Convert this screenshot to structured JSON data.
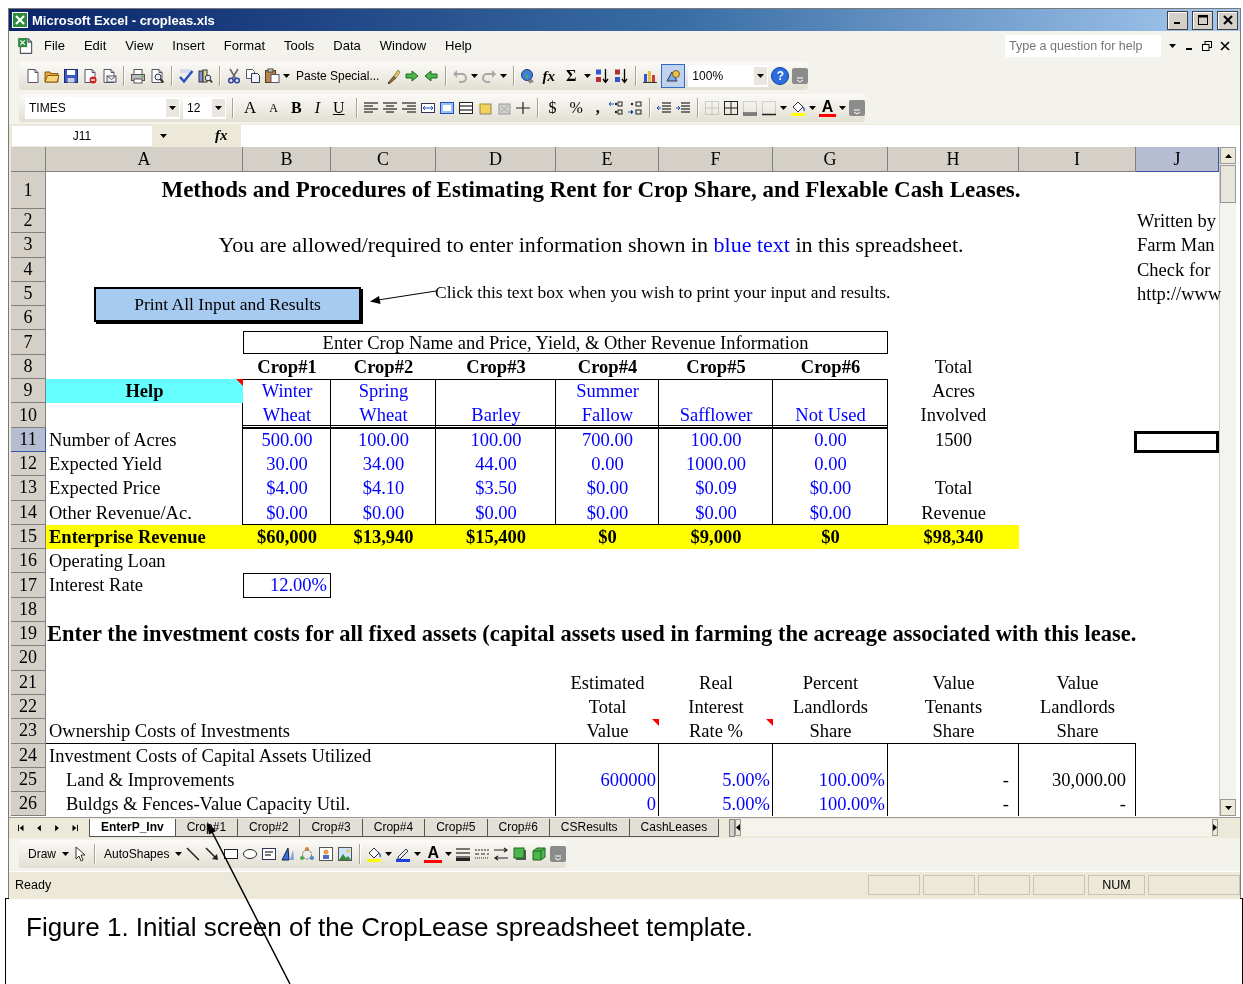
{
  "window": {
    "title": "Microsoft Excel - cropleas.xls"
  },
  "menu": [
    "File",
    "Edit",
    "View",
    "Insert",
    "Format",
    "Tools",
    "Data",
    "Window",
    "Help"
  ],
  "help_box": {
    "placeholder": "Type a question for help"
  },
  "standard_toolbar": {
    "paste_special": "Paste Special...",
    "undo": {
      "disabled": true
    },
    "redo": {
      "disabled": true
    },
    "function": "fx",
    "autosum": "Σ",
    "drawing": {
      "on": true
    },
    "zoom": "100%",
    "help": "?"
  },
  "formatting_toolbar": {
    "font": "TIMES",
    "size": "12",
    "grow_font": "A",
    "shrink_font": "A",
    "bold": "B",
    "italic": "I",
    "underline": "U",
    "currency": "$",
    "percent": "%",
    "comma": ",",
    "font_color": "A"
  },
  "formula_bar": {
    "name_box": "J11",
    "function": "fx"
  },
  "sheet": {
    "columns": [
      {
        "label": "A",
        "selected": false
      },
      {
        "label": "B",
        "selected": false
      },
      {
        "label": "C",
        "selected": false
      },
      {
        "label": "D",
        "selected": false
      },
      {
        "label": "E",
        "selected": false
      },
      {
        "label": "F",
        "selected": false
      },
      {
        "label": "G",
        "selected": false
      },
      {
        "label": "H",
        "selected": false
      },
      {
        "label": "I",
        "selected": false
      },
      {
        "label": "J",
        "selected": true
      }
    ],
    "rows": [
      {
        "number": "1",
        "selected": false,
        "cells": [
          {
            "kind": "title",
            "colspan": 9,
            "text": "Methods and Procedures of Estimating Rent for Crop Share, and Flexable Cash Leases."
          }
        ]
      },
      {
        "number": "2",
        "selected": false,
        "cells": [
          "",
          "",
          "",
          "",
          "",
          "",
          "",
          "",
          "",
          {
            "kind": "note",
            "text": "Written by"
          }
        ]
      },
      {
        "number": "3",
        "selected": false,
        "cells": [
          {
            "kind": "instruction",
            "colspan": 9,
            "segments": [
              {
                "kind": "plain",
                "text": "You are allowed/required to enter information shown in"
              },
              {
                "kind": "input",
                "text": "blue text"
              },
              {
                "kind": "plain",
                "text": "in this spreadsheet."
              }
            ]
          },
          "",
          "",
          "",
          "",
          "",
          "",
          "",
          "",
          {
            "kind": "note",
            "text": "Farm Man"
          }
        ]
      },
      {
        "number": "4",
        "selected": false,
        "cells": [
          "",
          "",
          "",
          "",
          "",
          "",
          "",
          "",
          "",
          {
            "kind": "note",
            "text": "Check for"
          }
        ]
      },
      {
        "number": "5",
        "selected": false,
        "cells": [
          "",
          "",
          "",
          "",
          "",
          "",
          "",
          "",
          "",
          {
            "kind": "note",
            "text": "http://www"
          }
        ]
      },
      {
        "number": "6",
        "selected": false,
        "cells": []
      },
      {
        "number": "7",
        "selected": false,
        "cells": [
          "",
          {
            "kind": "group",
            "colspan": 6,
            "text": "Enter Crop Name and Price, Yield, & Other Revenue Information"
          }
        ]
      },
      {
        "number": "8",
        "selected": false,
        "cells": [
          "",
          {
            "kind": "crop-head",
            "text": "Crop#1"
          },
          {
            "kind": "crop-head",
            "text": "Crop#2"
          },
          {
            "kind": "crop-head",
            "text": "Crop#3"
          },
          {
            "kind": "crop-head",
            "text": "Crop#4"
          },
          {
            "kind": "crop-head",
            "text": "Crop#5"
          },
          {
            "kind": "crop-head",
            "text": "Crop#6"
          },
          {
            "kind": "total",
            "text": "Total"
          }
        ]
      },
      {
        "number": "9",
        "selected": false,
        "cells": [
          {
            "kind": "help",
            "comment": true,
            "text": "Help"
          },
          {
            "kind": "input",
            "text": "Winter"
          },
          {
            "kind": "input",
            "text": "Spring"
          },
          "",
          {
            "kind": "input",
            "text": "Summer"
          },
          "",
          "",
          {
            "kind": "total",
            "text": "Acres"
          }
        ]
      },
      {
        "number": "10",
        "selected": false,
        "cells": [
          "",
          {
            "kind": "input",
            "text": "Wheat"
          },
          {
            "kind": "input",
            "text": "Wheat"
          },
          {
            "kind": "input",
            "text": "Barley"
          },
          {
            "kind": "input",
            "text": "Fallow"
          },
          {
            "kind": "input",
            "text": "Safflower"
          },
          {
            "kind": "input",
            "text": "Not Used"
          },
          {
            "kind": "total",
            "text": "Involved"
          }
        ]
      },
      {
        "number": "11",
        "selected": true,
        "cells": [
          {
            "kind": "label",
            "text": "Number of Acres"
          },
          {
            "kind": "input",
            "text": "500.00"
          },
          {
            "kind": "input",
            "text": "100.00"
          },
          {
            "kind": "input",
            "text": "100.00"
          },
          {
            "kind": "input",
            "text": "700.00"
          },
          {
            "kind": "input",
            "text": "100.00"
          },
          {
            "kind": "input",
            "text": "0.00"
          },
          {
            "kind": "total",
            "text": "1500"
          }
        ]
      },
      {
        "number": "12",
        "selected": false,
        "cells": [
          {
            "kind": "label",
            "text": "Expected Yield"
          },
          {
            "kind": "input",
            "text": "30.00"
          },
          {
            "kind": "input",
            "text": "34.00"
          },
          {
            "kind": "input",
            "text": "44.00"
          },
          {
            "kind": "input",
            "text": "0.00"
          },
          {
            "kind": "input",
            "text": "1000.00"
          },
          {
            "kind": "input",
            "text": "0.00"
          }
        ]
      },
      {
        "number": "13",
        "selected": false,
        "cells": [
          {
            "kind": "label",
            "text": "Expected Price"
          },
          {
            "kind": "input",
            "text": "$4.00"
          },
          {
            "kind": "input",
            "text": "$4.10"
          },
          {
            "kind": "input",
            "text": "$3.50"
          },
          {
            "kind": "input",
            "text": "$0.00"
          },
          {
            "kind": "input",
            "text": "$0.09"
          },
          {
            "kind": "input",
            "text": "$0.00"
          },
          {
            "kind": "total",
            "text": "Total"
          }
        ]
      },
      {
        "number": "14",
        "selected": false,
        "cells": [
          {
            "kind": "label",
            "text": "Other Revenue/Ac."
          },
          {
            "kind": "input",
            "text": "$0.00"
          },
          {
            "kind": "input",
            "text": "$0.00"
          },
          {
            "kind": "input",
            "text": "$0.00"
          },
          {
            "kind": "input",
            "text": "$0.00"
          },
          {
            "kind": "input",
            "text": "$0.00"
          },
          {
            "kind": "input",
            "text": "$0.00"
          },
          {
            "kind": "total",
            "text": "Revenue"
          }
        ]
      },
      {
        "number": "15",
        "selected": false,
        "cells": [
          {
            "kind": "revenue-label",
            "text": "Enterprise Revenue"
          },
          {
            "kind": "revenue",
            "text": "$60,000"
          },
          {
            "kind": "revenue",
            "text": "$13,940"
          },
          {
            "kind": "revenue",
            "text": "$15,400"
          },
          {
            "kind": "revenue",
            "text": "$0"
          },
          {
            "kind": "revenue",
            "text": "$9,000"
          },
          {
            "kind": "revenue",
            "text": "$0"
          },
          {
            "kind": "revenue",
            "text": "$98,340"
          }
        ]
      },
      {
        "number": "16",
        "selected": false,
        "cells": [
          {
            "kind": "label",
            "text": "Operating Loan"
          }
        ]
      },
      {
        "number": "17",
        "selected": false,
        "cells": [
          {
            "kind": "label",
            "text": "Interest Rate"
          },
          {
            "kind": "input-box",
            "text": "12.00%"
          }
        ]
      },
      {
        "number": "18",
        "selected": false,
        "cells": []
      },
      {
        "number": "19",
        "selected": false,
        "cells": [
          {
            "kind": "section",
            "text": "Enter the investment costs for all fixed assets (capital assets used in farming the acreage associated with this lease."
          }
        ]
      },
      {
        "number": "20",
        "selected": false,
        "cells": []
      },
      {
        "number": "21",
        "selected": false,
        "cells": [
          "",
          "",
          "",
          "",
          {
            "kind": "col-head",
            "text": "Estimated"
          },
          {
            "kind": "col-head",
            "text": "Real"
          },
          {
            "kind": "col-head",
            "text": "Percent"
          },
          {
            "kind": "col-head",
            "text": "Value"
          },
          {
            "kind": "col-head",
            "text": "Value"
          }
        ]
      },
      {
        "number": "22",
        "selected": false,
        "cells": [
          "",
          "",
          "",
          "",
          {
            "kind": "col-head",
            "text": "Total"
          },
          {
            "kind": "col-head",
            "text": "Interest"
          },
          {
            "kind": "col-head",
            "text": "Landlords"
          },
          {
            "kind": "col-head",
            "text": "Tenants"
          },
          {
            "kind": "col-head",
            "text": "Landlords"
          }
        ]
      },
      {
        "number": "23",
        "selected": false,
        "cells": [
          {
            "kind": "label",
            "text": "Ownership Costs of Investments"
          },
          "",
          "",
          "",
          {
            "kind": "col-head",
            "comment": true,
            "text": "Value"
          },
          {
            "kind": "col-head",
            "comment": true,
            "text": "Rate %"
          },
          {
            "kind": "col-head",
            "text": "Share"
          },
          {
            "kind": "col-head",
            "text": "Share"
          },
          {
            "kind": "col-head",
            "text": "Share"
          }
        ]
      },
      {
        "number": "24",
        "selected": false,
        "cells": [
          {
            "kind": "label",
            "text": "Investment Costs of Capital Assets Utilized"
          }
        ]
      },
      {
        "number": "25",
        "selected": false,
        "cells": [
          {
            "kind": "sub-label",
            "text": "Land & Improvements"
          },
          "",
          "",
          "",
          {
            "kind": "input-right",
            "text": "600000"
          },
          {
            "kind": "input-right",
            "text": "5.00%"
          },
          {
            "kind": "input-right",
            "text": "100.00%"
          },
          {
            "kind": "value-right",
            "text": "-"
          },
          {
            "kind": "value-right",
            "text": "30,000.00"
          }
        ]
      },
      {
        "number": "26",
        "selected": false,
        "cells": [
          {
            "kind": "sub-label",
            "text": "Buldgs & Fences-Value Capacity Util."
          },
          "",
          "",
          "",
          {
            "kind": "input-right",
            "text": "0"
          },
          {
            "kind": "input-right",
            "text": "5.00%"
          },
          {
            "kind": "input-right",
            "text": "100.00%"
          },
          {
            "kind": "value-right",
            "text": "-"
          },
          {
            "kind": "value-right",
            "text": "-"
          }
        ]
      }
    ],
    "print_button": {
      "label": "Print All Input and Results"
    },
    "callout": {
      "text": "Click this text box when you wish to print your input and results."
    }
  },
  "sheet_tabs": [
    {
      "label": "EnterP_Inv",
      "selected": true
    },
    {
      "label": "Crop#1",
      "selected": false
    },
    {
      "label": "Crop#2",
      "selected": false
    },
    {
      "label": "Crop#3",
      "selected": false
    },
    {
      "label": "Crop#4",
      "selected": false
    },
    {
      "label": "Crop#5",
      "selected": false
    },
    {
      "label": "Crop#6",
      "selected": false
    },
    {
      "label": "CSResults",
      "selected": false
    },
    {
      "label": "CashLeases",
      "selected": false
    }
  ],
  "drawing_toolbar": {
    "draw": "Draw",
    "autoshapes": "AutoShapes",
    "font_color": "A"
  },
  "status_bar": {
    "status": "Ready",
    "num_lock": "NUM"
  },
  "caption": "Figure 1. Initial screen of the CropLease spreadsheet template."
}
